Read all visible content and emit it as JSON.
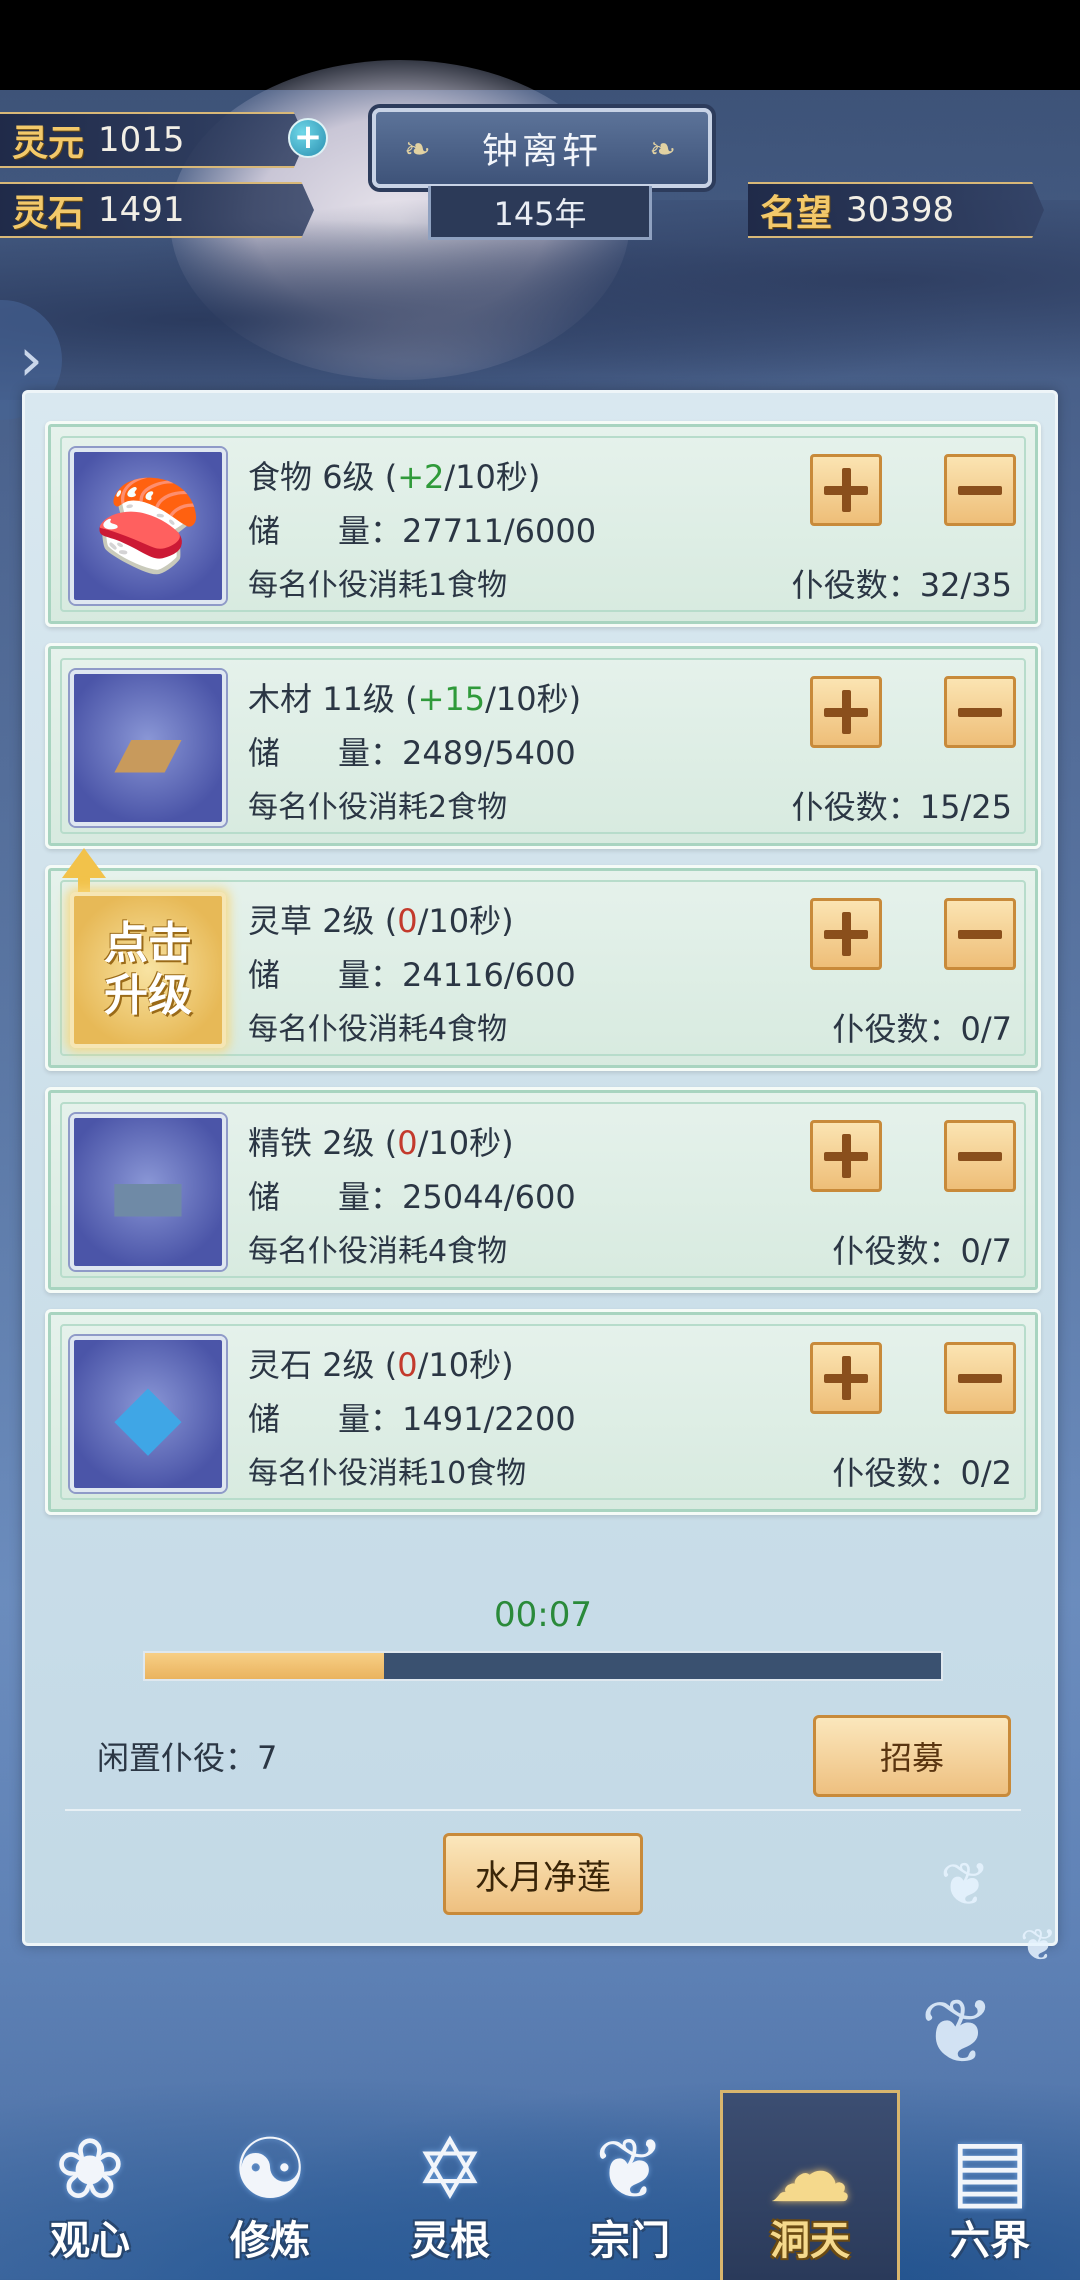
{
  "header": {
    "lingyuan_label": "灵元",
    "lingyuan_value": "1015",
    "lingshi_label": "灵石",
    "lingshi_value": "1491",
    "sect_name": "钟离轩",
    "year": "145年",
    "fame_label": "名望",
    "fame_value": "30398"
  },
  "resources": [
    {
      "name": "食物",
      "level": "6级",
      "rate_value": "+2",
      "rate_unit": "/10秒",
      "rate_state": "positive",
      "storage_label": "储",
      "storage_label2": "量：",
      "storage": "27711/6000",
      "consume": "每名仆役消耗1食物",
      "workers_label": "仆役数：",
      "workers": "32/35",
      "icon": "salmon-icon",
      "upgrade": false
    },
    {
      "name": "木材",
      "level": "11级",
      "rate_value": "+15",
      "rate_unit": "/10秒",
      "rate_state": "positive",
      "storage_label": "储",
      "storage_label2": "量：",
      "storage": "2489/5400",
      "consume": "每名仆役消耗2食物",
      "workers_label": "仆役数：",
      "workers": "15/25",
      "icon": "wood-plank-icon",
      "upgrade": false
    },
    {
      "name": "灵草",
      "level": "2级",
      "rate_value": "0",
      "rate_unit": "/10秒",
      "rate_state": "zero",
      "storage_label": "储",
      "storage_label2": "量：",
      "storage": "24116/600",
      "consume": "每名仆役消耗4食物",
      "workers_label": "仆役数：",
      "workers": "0/7",
      "icon": "upgrade-icon",
      "upgrade": true,
      "upgrade_text": "点击升级"
    },
    {
      "name": "精铁",
      "level": "2级",
      "rate_value": "0",
      "rate_unit": "/10秒",
      "rate_state": "zero",
      "storage_label": "储",
      "storage_label2": "量：",
      "storage": "25044/600",
      "consume": "每名仆役消耗4食物",
      "workers_label": "仆役数：",
      "workers": "0/7",
      "icon": "iron-ingot-icon",
      "upgrade": false
    },
    {
      "name": "灵石",
      "level": "2级",
      "rate_value": "0",
      "rate_unit": "/10秒",
      "rate_state": "zero",
      "storage_label": "储",
      "storage_label2": "量：",
      "storage": "1491/2200",
      "consume": "每名仆役消耗10食物",
      "workers_label": "仆役数：",
      "workers": "0/2",
      "icon": "spirit-crystal-icon",
      "upgrade": false
    }
  ],
  "timer": "00:07",
  "progress": 0.3,
  "idle": {
    "label": "闲置仆役：",
    "value": "7"
  },
  "recruit_label": "招募",
  "lotus_label": "水月净莲",
  "nav": [
    {
      "label": "观心",
      "icon": "pouch-icon",
      "glyph": "❀",
      "active": false
    },
    {
      "label": "修炼",
      "icon": "koi-icon",
      "glyph": "☯",
      "active": false
    },
    {
      "label": "灵根",
      "icon": "hexagram-icon",
      "glyph": "✡",
      "active": false
    },
    {
      "label": "宗门",
      "icon": "fan-icon",
      "glyph": "❦",
      "active": false
    },
    {
      "label": "洞天",
      "icon": "cloud-icon",
      "glyph": "☁",
      "active": true
    },
    {
      "label": "六界",
      "icon": "scroll-icon",
      "glyph": "▤",
      "active": false
    }
  ],
  "colors": {
    "accent_gold": "#f3c96a",
    "positive": "#2f9a3a",
    "zero": "#c33a2c",
    "progress": "#eab35e"
  }
}
